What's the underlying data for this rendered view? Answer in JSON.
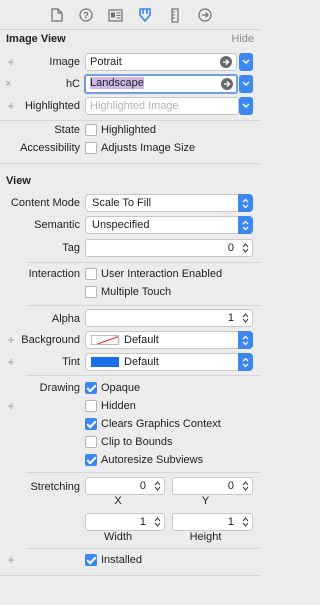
{
  "toolbar": {
    "icons": [
      "file-icon",
      "help-icon",
      "identity-icon",
      "attributes-icon",
      "ruler-icon",
      "connections-icon"
    ],
    "active_index": 3,
    "accent": "#3c87f0"
  },
  "image_view": {
    "title": "Image View",
    "hide": "Hide",
    "image_label": "Image",
    "image_value": "Potrait",
    "hc_label": "hC",
    "hc_value": "Landscape",
    "highlighted_label": "Highlighted",
    "highlighted_placeholder": "Highlighted Image",
    "state_label": "State",
    "state_checkbox": "Highlighted",
    "accessibility_label": "Accessibility",
    "accessibility_checkbox": "Adjusts Image Size"
  },
  "view": {
    "title": "View",
    "content_mode_label": "Content Mode",
    "content_mode_value": "Scale To Fill",
    "semantic_label": "Semantic",
    "semantic_value": "Unspecified",
    "tag_label": "Tag",
    "tag_value": "0",
    "interaction_label": "Interaction",
    "user_interaction": "User Interaction Enabled",
    "multiple_touch": "Multiple Touch",
    "alpha_label": "Alpha",
    "alpha_value": "1",
    "background_label": "Background",
    "background_value": "Default",
    "tint_label": "Tint",
    "tint_value": "Default",
    "tint_color": "#1a6ee8",
    "drawing_label": "Drawing",
    "opaque": "Opaque",
    "hidden": "Hidden",
    "clears_graphics": "Clears Graphics Context",
    "clip_bounds": "Clip to Bounds",
    "autoresize": "Autoresize Subviews",
    "stretching_label": "Stretching",
    "x_value": "0",
    "y_value": "0",
    "x_label": "X",
    "y_label": "Y",
    "width_value": "1",
    "height_value": "1",
    "width_label": "Width",
    "height_label": "Height",
    "installed": "Installed"
  },
  "checkbox_states": {
    "highlighted": false,
    "adjusts_image_size": false,
    "user_interaction": false,
    "multiple_touch": false,
    "opaque": true,
    "hidden": false,
    "clears_graphics": true,
    "clip_bounds": false,
    "autoresize": true,
    "installed": true
  }
}
